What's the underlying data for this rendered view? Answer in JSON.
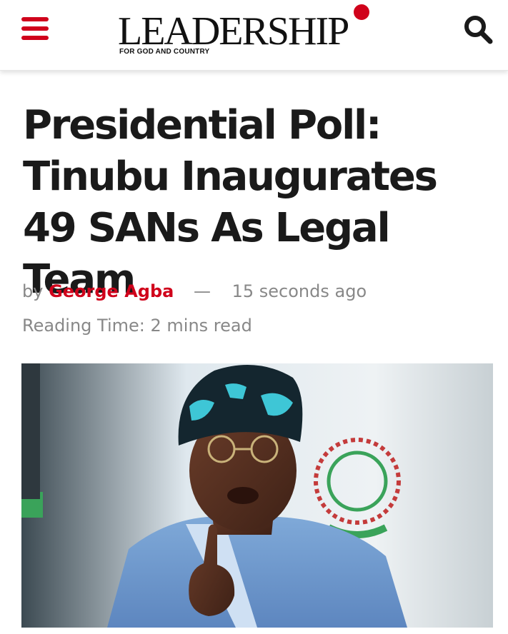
{
  "header": {
    "logo_text": "LEADERSHIP",
    "tagline": "FOR GOD AND COUNTRY",
    "menu_icon": "hamburger-menu-icon",
    "search_icon": "search-icon",
    "accent_color": "#d0021b"
  },
  "article": {
    "headline": "Presidential Poll: Tinubu Inaugurates 49 SANs As Legal Team",
    "by_label": "by",
    "author": "George Agba",
    "separator": "—",
    "timestamp": "15 seconds ago",
    "reading_time": "Reading Time: 2 mins read",
    "image_alt": "Tinubu speaking, wearing a blue patterned cap and glasses"
  }
}
